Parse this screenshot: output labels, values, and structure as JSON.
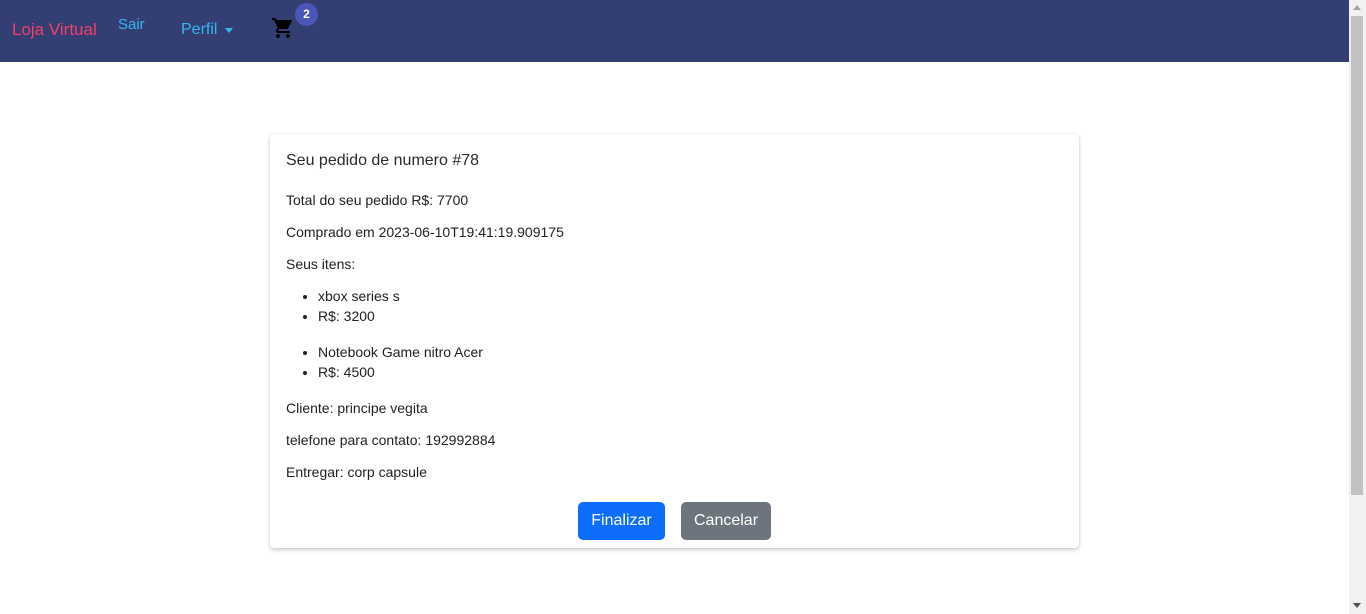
{
  "nav": {
    "brand": "Loja Virtual",
    "sair": "Sair",
    "perfil": "Perfil",
    "cart_icon": "shopping-cart-icon",
    "cart_count": "2"
  },
  "order": {
    "title": "Seu pedido de numero #78",
    "total": "Total do seu pedido R$: 7700",
    "purchased": "Comprado em 2023-06-10T19:41:19.909175",
    "items_label": "Seus itens:",
    "items": [
      {
        "name": "xbox series s",
        "price": "R$: 3200"
      },
      {
        "name": "Notebook Game nitro Acer",
        "price": "R$: 4500"
      }
    ],
    "client": "Cliente: principe vegita",
    "phone": "telefone para contato: 192992884",
    "deliver": "Entregar: corp capsule"
  },
  "actions": {
    "finalize": "Finalizar",
    "cancel": "Cancelar"
  },
  "colors": {
    "navbar": "#333f72",
    "brand": "#f53d6b",
    "nav_link": "#35b6f0",
    "primary": "#0d6efd",
    "secondary": "#6c757d"
  }
}
